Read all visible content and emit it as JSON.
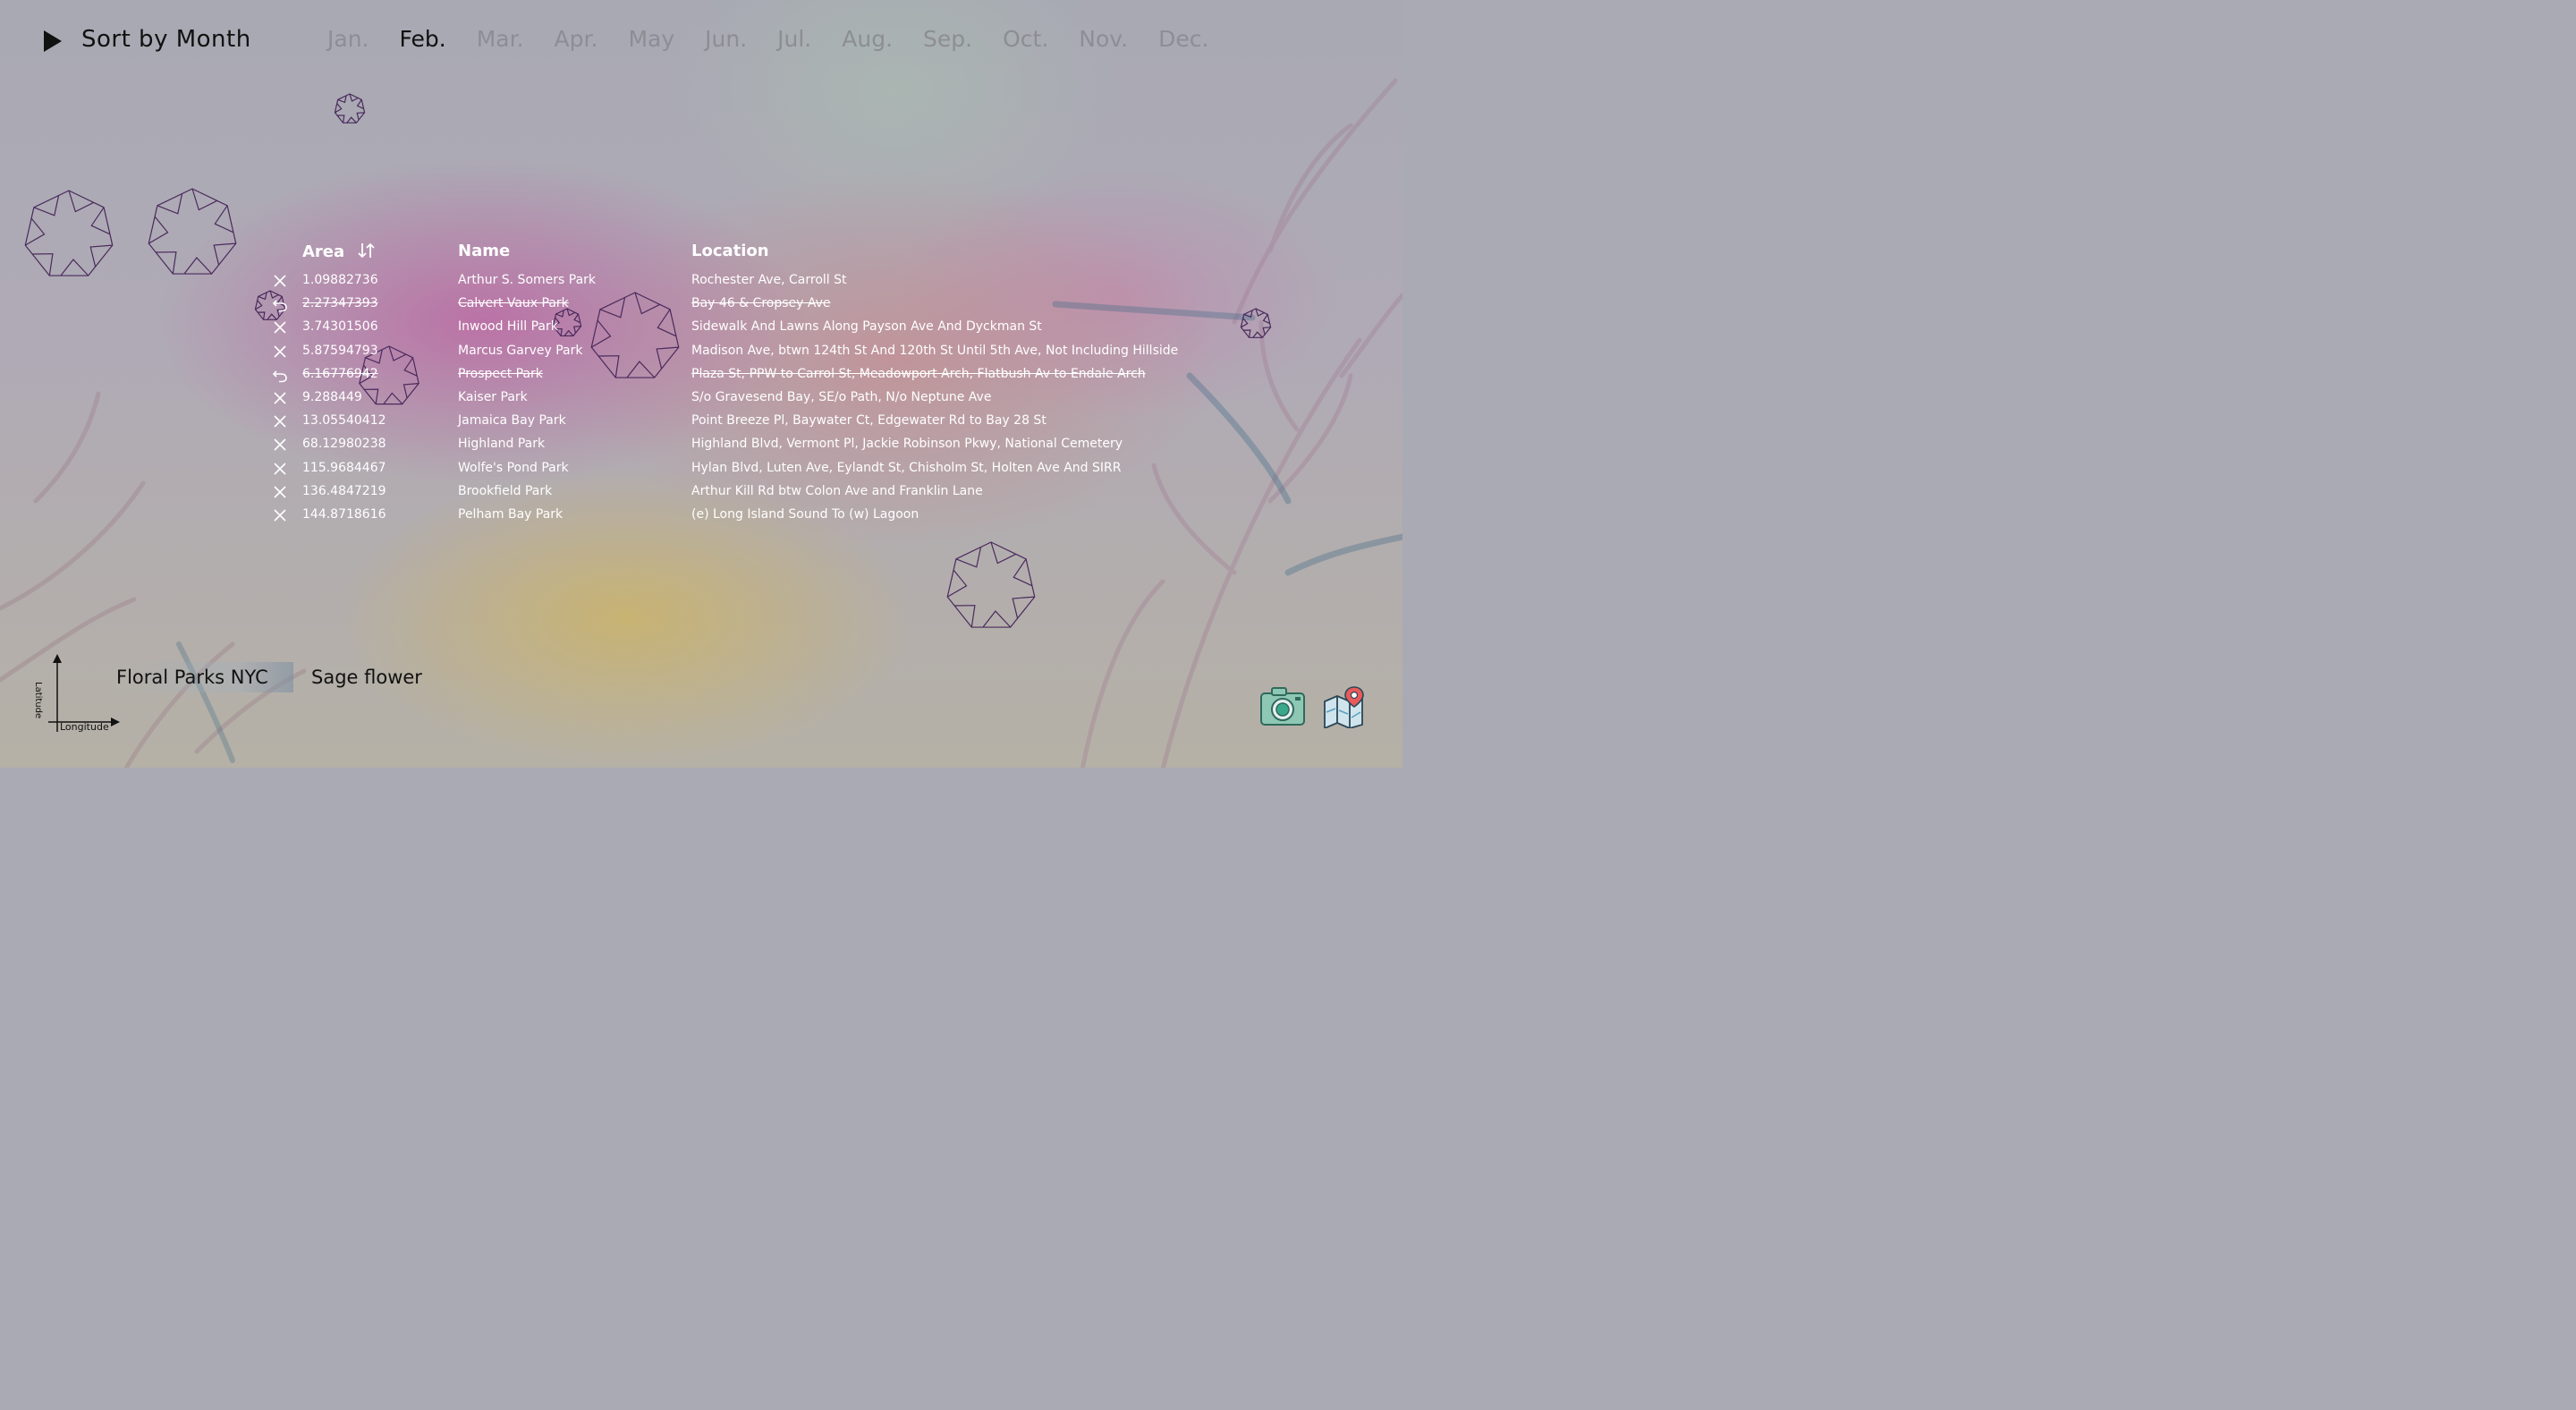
{
  "header": {
    "sort_label": "Sort by Month",
    "months": [
      "Jan.",
      "Feb.",
      "Mar.",
      "Apr.",
      "May",
      "Jun.",
      "Jul.",
      "Aug.",
      "Sep.",
      "Oct.",
      "Nov.",
      "Dec."
    ],
    "active_month": "Feb."
  },
  "table": {
    "columns": {
      "area": "Area",
      "name": "Name",
      "location": "Location"
    },
    "rows": [
      {
        "area": "1.09882736",
        "name": "Arthur S. Somers Park",
        "location": "Rochester Ave, Carroll St",
        "removed": false
      },
      {
        "area": "2.27347393",
        "name": "Calvert Vaux Park",
        "location": "Bay 46 & Cropsey Ave",
        "removed": true
      },
      {
        "area": "3.74301506",
        "name": "Inwood Hill Park",
        "location": "Sidewalk And Lawns Along Payson Ave And Dyckman St",
        "removed": false
      },
      {
        "area": "5.87594793",
        "name": "Marcus Garvey Park",
        "location": "Madison Ave, btwn 124th St And 120th St Until 5th Ave, Not Including Hillside",
        "removed": false
      },
      {
        "area": "6.16776942",
        "name": "Prospect Park",
        "location": "Plaza St, PPW to Carrol St, Meadowport Arch, Flatbush Av to Endale Arch",
        "removed": true
      },
      {
        "area": "9.288449",
        "name": "Kaiser Park",
        "location": "S/o Gravesend Bay, SE/o Path, N/o Neptune Ave",
        "removed": false
      },
      {
        "area": "13.05540412",
        "name": "Jamaica Bay Park",
        "location": "Point Breeze Pl, Baywater Ct, Edgewater Rd to Bay 28 St",
        "removed": false
      },
      {
        "area": "68.12980238",
        "name": "Highland Park",
        "location": "Highland Blvd, Vermont Pl, Jackie Robinson Pkwy, National Cemetery",
        "removed": false
      },
      {
        "area": "115.9684467",
        "name": "Wolfe's Pond Park",
        "location": "Hylan Blvd, Luten Ave, Eylandt St, Chisholm St, Holten Ave And SIRR",
        "removed": false
      },
      {
        "area": "136.4847219",
        "name": "Brookfield Park",
        "location": "Arthur Kill Rd btw Colon Ave and Franklin Lane",
        "removed": false
      },
      {
        "area": "144.8718616",
        "name": "Pelham Bay Park",
        "location": "(e) Long Island Sound To (w) Lagoon",
        "removed": false
      }
    ]
  },
  "axis": {
    "y_label": "Latitude",
    "x_label": "Longitude"
  },
  "footer": {
    "dataset_button": "Floral Parks NYC",
    "flower_label": "Sage flower"
  },
  "icons": {
    "play": "play-icon",
    "sort": "sort-arrows-icon",
    "remove": "close-icon",
    "restore": "undo-icon",
    "camera": "camera-icon",
    "map": "map-pin-icon"
  },
  "colors": {
    "flower_stroke": "#4a2a5c",
    "text_light": "#ffffff",
    "text_dark": "#111111",
    "inactive_month": "#8c8e94"
  }
}
